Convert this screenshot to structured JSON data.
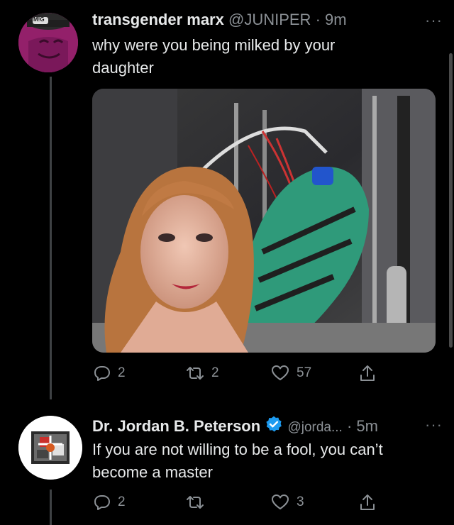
{
  "tweet1": {
    "display_name": "transgender marx",
    "handle": "@JUNIPER",
    "separator": "·",
    "time": "9m",
    "text": "why were you being milked by your daughter",
    "avatar_badge": "M!G",
    "media_icon": "photo-image",
    "actions": {
      "reply_count": "2",
      "retweet_count": "2",
      "like_count": "57"
    }
  },
  "tweet2": {
    "display_name": "Dr. Jordan B. Peterson",
    "handle": "@jorda...",
    "separator": "·",
    "time": "5m",
    "text": "If you are not willing to be a fool, you can’t become a master",
    "actions": {
      "reply_count": "2",
      "retweet_count": "",
      "like_count": "3"
    }
  },
  "more_menu": "···",
  "colors": {
    "background": "#000000",
    "text_primary": "#e7e9ea",
    "text_secondary": "#8b9095",
    "verified_blue": "#1d9bf0",
    "thread_line": "#3e4144"
  }
}
